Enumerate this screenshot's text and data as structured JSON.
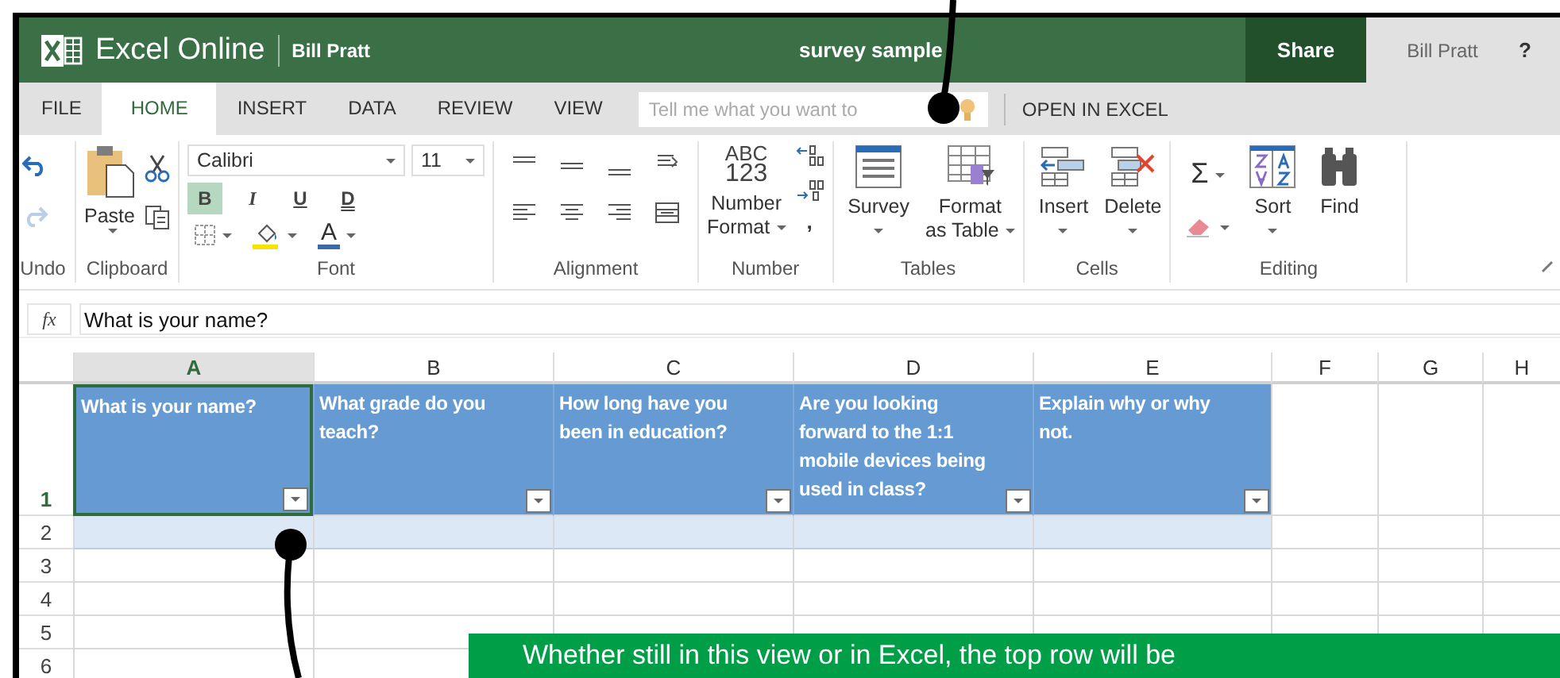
{
  "title_bar": {
    "app_name": "Excel Online",
    "owner": "Bill Pratt",
    "document": "survey sample",
    "share": "Share",
    "account": "Bill Pratt",
    "help": "?"
  },
  "tabs": [
    {
      "label": "FILE",
      "selected": false
    },
    {
      "label": "HOME",
      "selected": true
    },
    {
      "label": "INSERT",
      "selected": false
    },
    {
      "label": "DATA",
      "selected": false
    },
    {
      "label": "REVIEW",
      "selected": false
    },
    {
      "label": "VIEW",
      "selected": false
    }
  ],
  "tell_me": {
    "placeholder": "Tell me what you want to"
  },
  "open_in_excel": "OPEN IN EXCEL",
  "ribbon": [
    {
      "kind": "undo",
      "label": "Undo",
      "items": [
        {
          "disabled": false
        },
        {
          "disabled": true
        }
      ]
    },
    {
      "kind": "clipboard",
      "label": "Clipboard",
      "paste": "Paste"
    },
    {
      "kind": "font",
      "label": "Font",
      "font_name": "Calibri",
      "font_size": "11",
      "styles": [
        {
          "label": "B",
          "selected": true
        },
        {
          "label": "I",
          "selected": false
        },
        {
          "label": "U",
          "selected": false
        },
        {
          "label": "D",
          "selected": false
        }
      ],
      "font_color": "A"
    },
    {
      "kind": "alignment",
      "label": "Alignment"
    },
    {
      "kind": "number",
      "label": "Number",
      "icon_lines": [
        "ABC",
        "123"
      ],
      "button_lines": [
        "Number",
        "Format"
      ],
      "comma": ","
    },
    {
      "kind": "tables",
      "label": "Tables",
      "buttons": [
        {
          "lines": [
            "Survey"
          ]
        },
        {
          "lines": [
            "Format",
            "as Table"
          ]
        }
      ]
    },
    {
      "kind": "cells",
      "label": "Cells",
      "buttons": [
        {
          "lines": [
            "Insert"
          ]
        },
        {
          "lines": [
            "Delete"
          ]
        }
      ]
    },
    {
      "kind": "editing",
      "label": "Editing",
      "sigma": "Σ",
      "buttons": [
        {
          "lines": [
            "Sort"
          ]
        },
        {
          "lines": [
            "Find"
          ]
        }
      ]
    }
  ],
  "formula_bar": {
    "label": "fx",
    "value": "What is your name?"
  },
  "sheet": {
    "columns": [
      {
        "label": "A",
        "selected": true
      },
      {
        "label": "B",
        "selected": false
      },
      {
        "label": "C",
        "selected": false
      },
      {
        "label": "D",
        "selected": false
      },
      {
        "label": "E",
        "selected": false
      },
      {
        "label": "F",
        "selected": false
      },
      {
        "label": "G",
        "selected": false
      },
      {
        "label": "H",
        "selected": false
      }
    ],
    "rows": [
      {
        "label": "1",
        "selected": true
      },
      {
        "label": "2",
        "selected": false
      },
      {
        "label": "3",
        "selected": false
      },
      {
        "label": "4",
        "selected": false
      },
      {
        "label": "5",
        "selected": false
      },
      {
        "label": "6",
        "selected": false
      }
    ],
    "header_cells": [
      {
        "text": "What is your name?",
        "selected": true
      },
      {
        "text": "What grade do you teach?",
        "selected": false
      },
      {
        "text": "How long have you been in education?",
        "selected": false
      },
      {
        "text": "Are you looking forward to the 1:1 mobile devices being used in class?",
        "selected": false
      },
      {
        "text": "Explain why or why not.",
        "selected": false
      }
    ]
  },
  "callout": {
    "text": "Whether still in this view or in Excel, the top row will be"
  }
}
